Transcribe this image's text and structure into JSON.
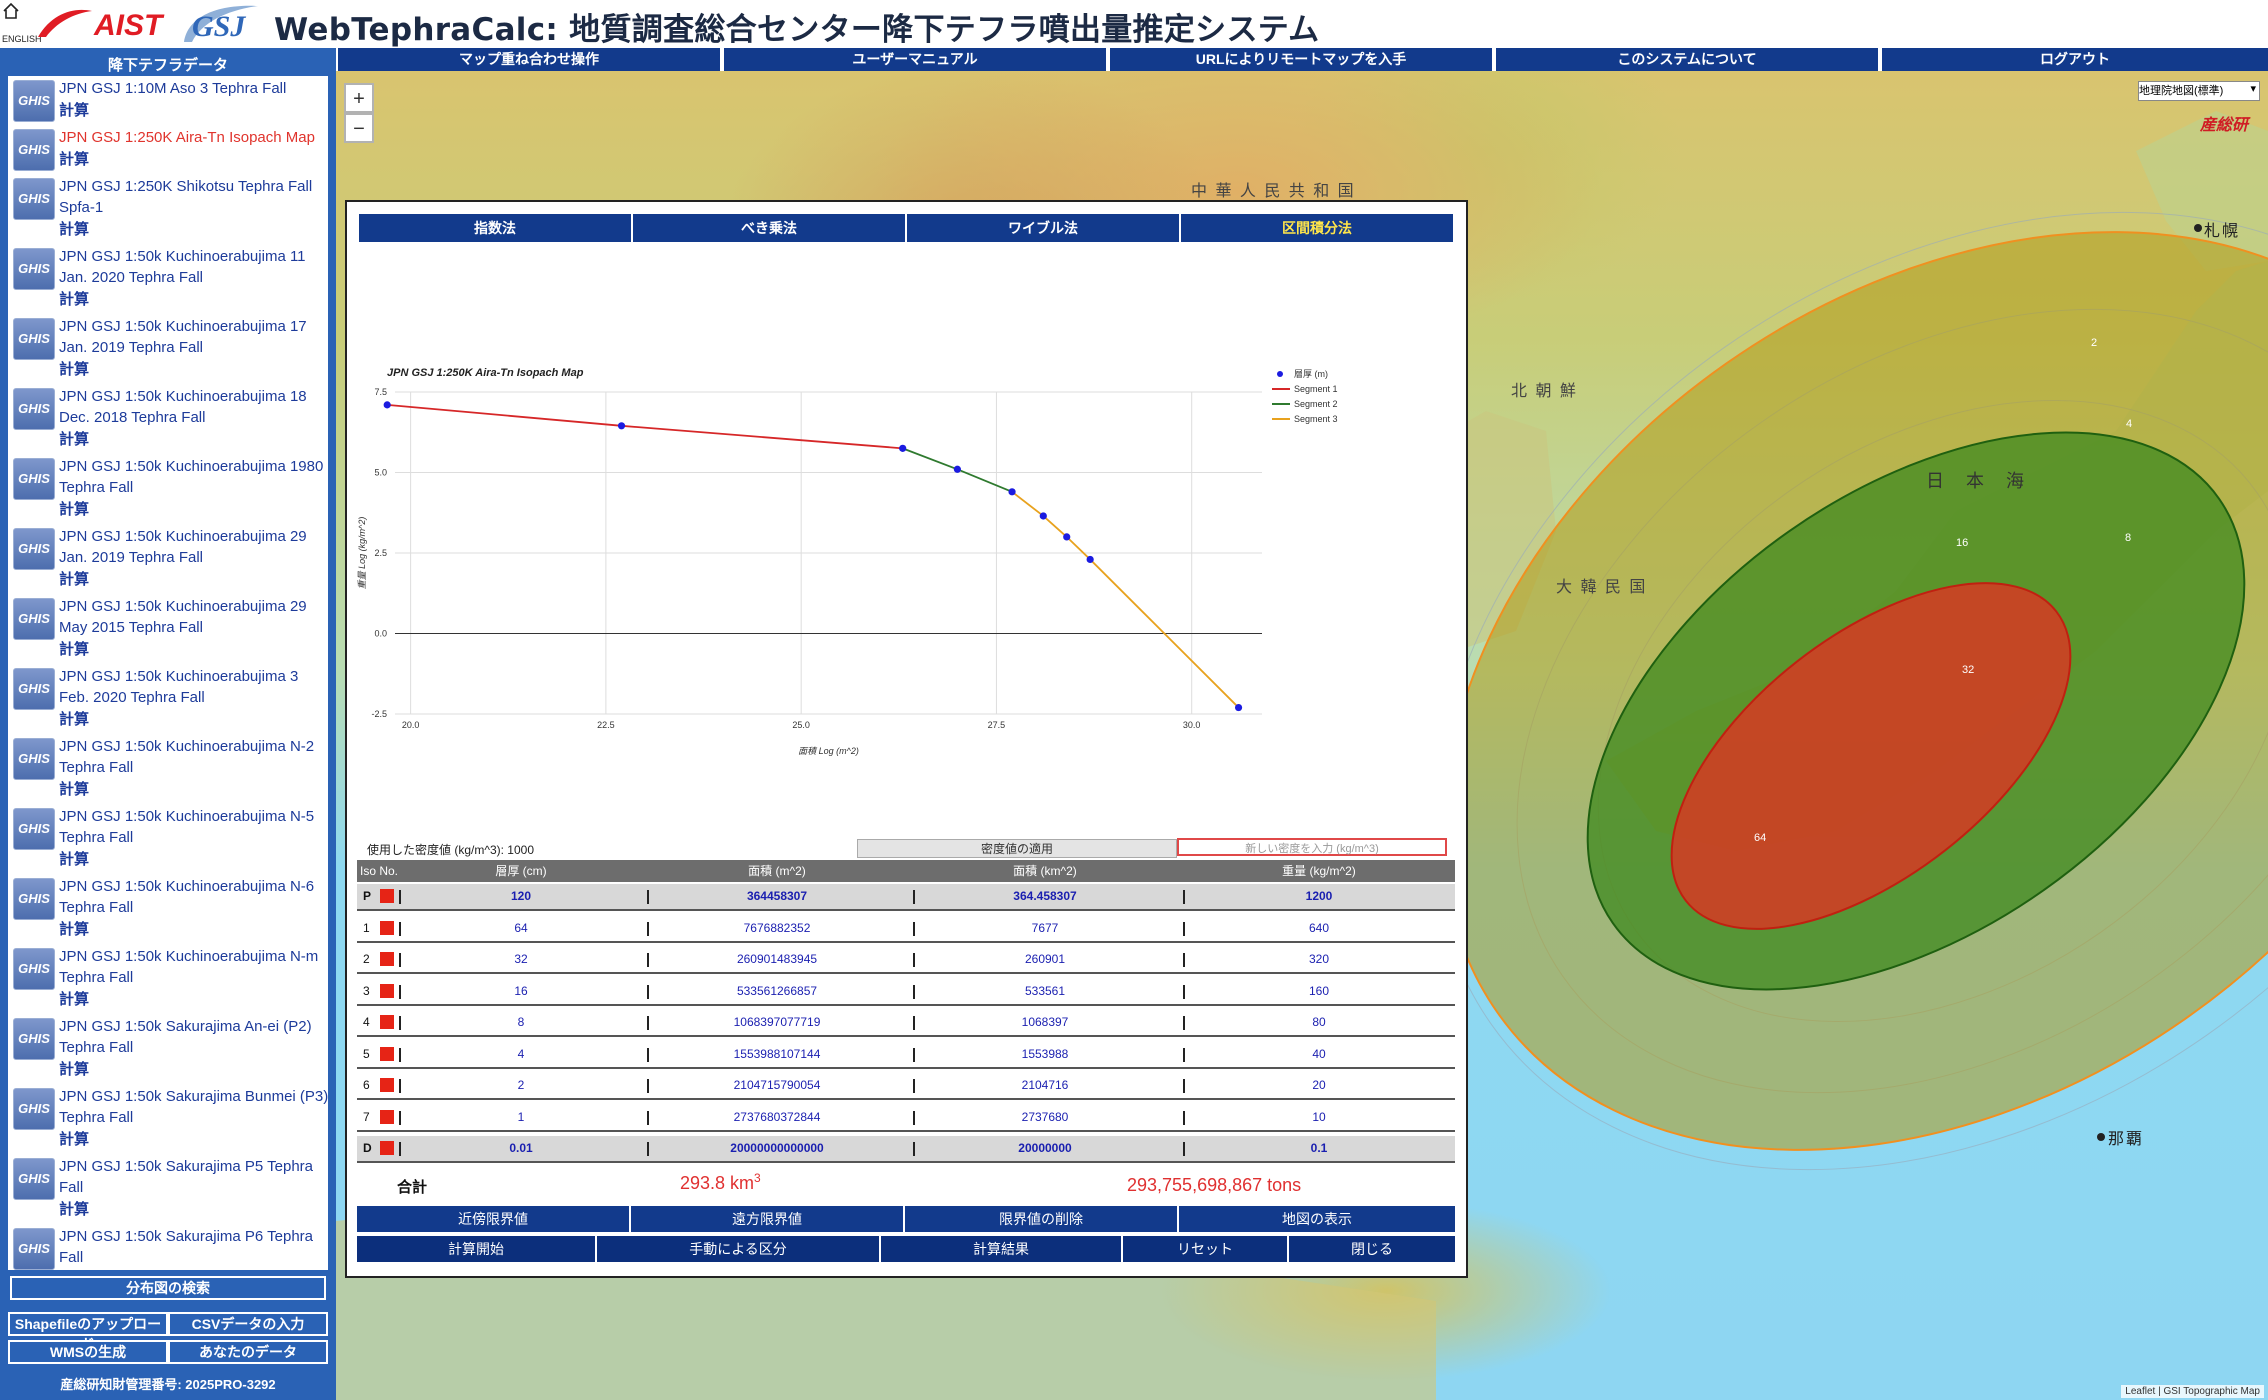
{
  "header": {
    "english": "ENGLISH",
    "aist_text": "AIST",
    "title": "WebTephraCalc: 地質調査総合センター降下テフラ噴出量推定システム"
  },
  "sidebar": {
    "title": "降下テフラデータ",
    "calc_label": "計算",
    "icon_label": "GHIS",
    "items": [
      {
        "name": "JPN GSJ 1:10M Aso 3 Tephra Fall"
      },
      {
        "name": "JPN GSJ 1:250K Aira-Tn Isopach Map"
      },
      {
        "name": "JPN GSJ 1:250K Shikotsu Tephra Fall Spfa-1"
      },
      {
        "name": "JPN GSJ 1:50k Kuchinoerabujima 11 Jan. 2020 Tephra Fall"
      },
      {
        "name": "JPN GSJ 1:50k Kuchinoerabujima 17 Jan. 2019 Tephra Fall"
      },
      {
        "name": "JPN GSJ 1:50k Kuchinoerabujima 18 Dec. 2018 Tephra Fall"
      },
      {
        "name": "JPN GSJ 1:50k Kuchinoerabujima 1980 Tephra Fall"
      },
      {
        "name": "JPN GSJ 1:50k Kuchinoerabujima 29 Jan. 2019 Tephra Fall"
      },
      {
        "name": "JPN GSJ 1:50k Kuchinoerabujima 29 May 2015 Tephra Fall"
      },
      {
        "name": "JPN GSJ 1:50k Kuchinoerabujima 3 Feb. 2020 Tephra Fall"
      },
      {
        "name": "JPN GSJ 1:50k Kuchinoerabujima N-2 Tephra Fall"
      },
      {
        "name": "JPN GSJ 1:50k Kuchinoerabujima N-5 Tephra Fall"
      },
      {
        "name": "JPN GSJ 1:50k Kuchinoerabujima N-6 Tephra Fall"
      },
      {
        "name": "JPN GSJ 1:50k Kuchinoerabujima N-m Tephra Fall"
      },
      {
        "name": "JPN GSJ 1:50k Sakurajima An-ei (P2) Tephra Fall"
      },
      {
        "name": "JPN GSJ 1:50k Sakurajima Bunmei (P3) Tephra Fall"
      },
      {
        "name": "JPN GSJ 1:50k Sakurajima P5 Tephra Fall"
      },
      {
        "name": "JPN GSJ 1:50k Sakurajima P6 Tephra Fall"
      }
    ],
    "search_btn": "分布図の検索",
    "shapefile_btn": "Shapefileのアップロード",
    "csv_btn": "CSVデータの入力",
    "wms_btn": "WMSの生成",
    "your_data_btn": "あなたのデータ",
    "ip_number": "産総研知財管理番号: 2025PRO-3292"
  },
  "nav": {
    "items": [
      "マップ重ね合わせ操作",
      "ユーザーマニュアル",
      "URLによりリモートマップを入手",
      "このシステムについて",
      "ログアウト"
    ]
  },
  "map": {
    "zoom_in": "+",
    "zoom_out": "−",
    "basemap_option": "地理院地図(標準)",
    "labels": {
      "china": "中 華 人 民 共 和 国",
      "korea_n": "北 朝 鮮",
      "korea_s": "大 韓 民 国",
      "sea_japan": "日　本　海",
      "naha": "那覇",
      "sapporo": "札幌"
    },
    "contour_labels": [
      "2",
      "4",
      "8",
      "16",
      "32",
      "64"
    ],
    "credit": "Leaflet | GSI Topographic Map",
    "aist_mark": "産総研"
  },
  "panel": {
    "tabs": [
      "指数法",
      "べき乗法",
      "ワイブル法",
      "区間積分法"
    ],
    "density_used": "使用した密度値 (kg/m^3): 1000",
    "density_apply": "密度値の適用",
    "density_placeholder": "新しい密度を入力 (kg/m^3)",
    "table": {
      "headers": [
        "Iso No.",
        "層厚 (cm)",
        "面積 (m^2)",
        "面積 (km^2)",
        "重量 (kg/m^2)"
      ],
      "rows": [
        [
          "P",
          "120",
          "364458307",
          "364.458307",
          "1200"
        ],
        [
          "1",
          "64",
          "7676882352",
          "7677",
          "640"
        ],
        [
          "2",
          "32",
          "260901483945",
          "260901",
          "320"
        ],
        [
          "3",
          "16",
          "533561266857",
          "533561",
          "160"
        ],
        [
          "4",
          "8",
          "1068397077719",
          "1068397",
          "80"
        ],
        [
          "5",
          "4",
          "1553988107144",
          "1553988",
          "40"
        ],
        [
          "6",
          "2",
          "2104715790054",
          "2104716",
          "20"
        ],
        [
          "7",
          "1",
          "2737680372844",
          "2737680",
          "10"
        ],
        [
          "D",
          "0.01",
          "20000000000000",
          "20000000",
          "0.1"
        ]
      ]
    },
    "total_label": "合計",
    "total_volume": "293.8 km",
    "total_volume_sup": "3",
    "total_mass": "293,755,698,867 tons",
    "buttons_row1": [
      "近傍限界値",
      "遠方限界値",
      "限界値の削除",
      "地図の表示"
    ],
    "buttons_row2": [
      "計算開始",
      "手動による区分",
      "計算結果",
      "リセット",
      "閉じる"
    ]
  },
  "chart_data": {
    "type": "line",
    "title": "JPN GSJ 1:250K Aira-Tn Isopach Map",
    "xlabel": "面積 Log (m^2)",
    "ylabel": "重量 Log (kg/m^2)",
    "xlim": [
      19.8,
      30.9
    ],
    "ylim": [
      -2.5,
      7.5
    ],
    "xticks": [
      "20.0",
      "22.5",
      "25.0",
      "27.5",
      "30.0"
    ],
    "yticks": [
      "7.5",
      "5.0",
      "2.5",
      "0.0",
      "-2.5"
    ],
    "points": {
      "name": "層厚 (m)",
      "x": [
        19.7,
        22.7,
        26.3,
        27.0,
        27.7,
        28.1,
        28.4,
        28.7,
        30.6
      ],
      "y": [
        7.1,
        6.45,
        5.75,
        5.1,
        4.4,
        3.65,
        3.0,
        2.3,
        -2.3
      ]
    },
    "series": [
      {
        "name": "Segment 1",
        "color": "#d62728",
        "x": [
          19.7,
          22.7,
          26.3
        ],
        "y": [
          7.1,
          6.45,
          5.75
        ]
      },
      {
        "name": "Segment 2",
        "color": "#2f7a2f",
        "x": [
          26.3,
          27.0,
          27.7
        ],
        "y": [
          5.75,
          5.1,
          4.4
        ]
      },
      {
        "name": "Segment 3",
        "color": "#e8a21e",
        "x": [
          27.7,
          28.1,
          28.4,
          28.7,
          30.6
        ],
        "y": [
          4.4,
          3.65,
          3.0,
          2.3,
          -2.3
        ]
      }
    ],
    "legend_position": "top-right",
    "grid": true
  }
}
